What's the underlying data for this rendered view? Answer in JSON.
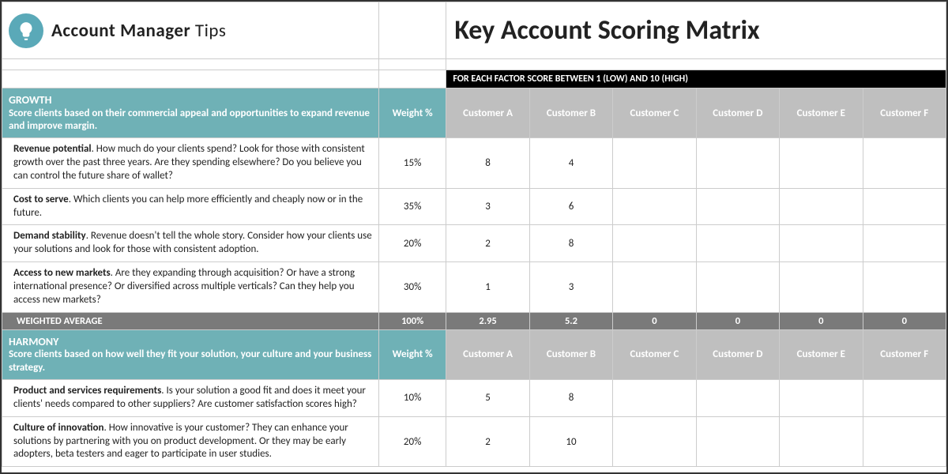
{
  "brand": {
    "name_bold": "Account Manager",
    "name_light": "Tips"
  },
  "title": "Key Account Scoring Matrix",
  "instruction": "FOR EACH FACTOR SCORE BETWEEN 1 (LOW) AND 10 (HIGH)",
  "weight_label": "Weight %",
  "customers": [
    "Customer A",
    "Customer B",
    "Customer C",
    "Customer D",
    "Customer E",
    "Customer F"
  ],
  "sections": [
    {
      "name": "GROWTH",
      "desc": "Score clients based on their commercial appeal and opportunities to expand revenue and improve margin.",
      "rows": [
        {
          "factor": "Revenue potential",
          "text": ". How much do your clients spend? Look for those with consistent growth over the past three years. Are they spending elsewhere? Do you believe you can control the future share of wallet?",
          "weight": "15%",
          "scores": [
            "8",
            "4",
            "",
            "",
            "",
            ""
          ]
        },
        {
          "factor": "Cost to serve",
          "text": ". Which clients you can help more efficiently and cheaply now or in the future.",
          "weight": "35%",
          "scores": [
            "3",
            "6",
            "",
            "",
            "",
            ""
          ]
        },
        {
          "factor": "Demand stability",
          "text": ". Revenue doesn't tell the whole story. Consider how your clients use your solutions and look for those with consistent adoption.",
          "weight": "20%",
          "scores": [
            "2",
            "8",
            "",
            "",
            "",
            ""
          ]
        },
        {
          "factor": "Access to new markets",
          "text": ". Are they expanding through acquisition? Or have a strong international presence? Or diversified across multiple verticals? Can they help you access new markets?",
          "weight": "30%",
          "scores": [
            "1",
            "3",
            "",
            "",
            "",
            ""
          ]
        }
      ],
      "avg_label": "WEIGHTED AVERAGE",
      "avg_weight": "100%",
      "avg_scores": [
        "2.95",
        "5.2",
        "0",
        "0",
        "0",
        "0"
      ]
    },
    {
      "name": "HARMONY",
      "desc": "Score clients based on how well they fit your solution, your culture and your business strategy.",
      "rows": [
        {
          "factor": "Product and services requirements",
          "text": ". Is your solution a good fit and does it meet your clients' needs compared to other suppliers? Are customer satisfaction scores high?",
          "weight": "10%",
          "scores": [
            "5",
            "8",
            "",
            "",
            "",
            ""
          ]
        },
        {
          "factor": "Culture of innovation",
          "text": ". How innovative is your customer? They can enhance your solutions by partnering with you on product development. Or they may be early adopters, beta testers and eager to participate in user studies.",
          "weight": "20%",
          "scores": [
            "2",
            "10",
            "",
            "",
            "",
            ""
          ]
        }
      ]
    }
  ]
}
